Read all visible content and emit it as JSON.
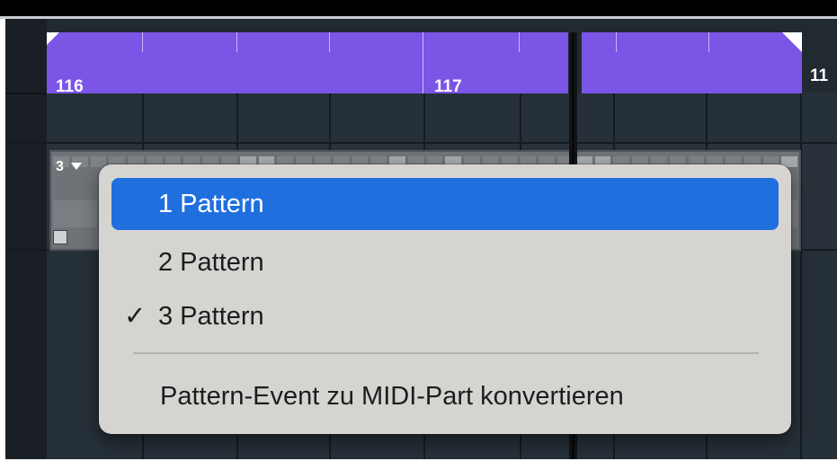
{
  "ruler": {
    "bars": [
      "116",
      "117",
      "11"
    ],
    "color": "#7a55e6"
  },
  "pattern_event": {
    "pattern_number": "3",
    "dropdown_icon": "triangle-down-icon"
  },
  "context_menu": {
    "items": [
      {
        "label": "1 Pattern",
        "checked": false,
        "highlighted": true
      },
      {
        "label": "2 Pattern",
        "checked": false,
        "highlighted": false
      },
      {
        "label": "3 Pattern",
        "checked": true,
        "highlighted": false
      }
    ],
    "check_mark": "✓",
    "action_label": "Pattern-Event zu MIDI-Part konvertieren",
    "highlight_color": "#1f6fde"
  }
}
